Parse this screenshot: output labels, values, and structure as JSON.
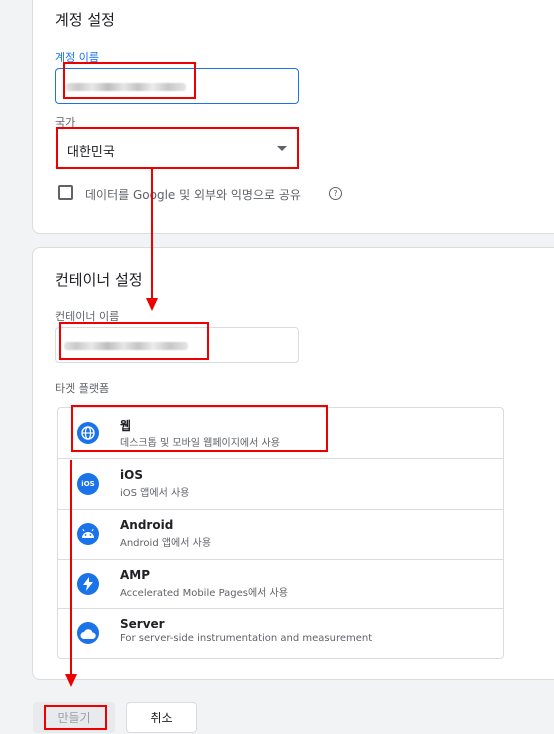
{
  "account_settings": {
    "title": "계정 설정",
    "account_name_label": "계정 이름",
    "country_label": "국가",
    "country_value": "대한민국",
    "share_data_label": "데이터를 Google 및 외부와 익명으로 공유",
    "help_glyph": "?"
  },
  "container_settings": {
    "title": "컨테이너 설정",
    "container_name_label": "컨테이너 이름",
    "target_platform_label": "타겟 플랫폼",
    "platforms": [
      {
        "icon": "globe-icon",
        "glyph": "⊕",
        "title": "웹",
        "desc": "데스크톱 및 모바일 웹페이지에서 사용"
      },
      {
        "icon": "ios-icon",
        "glyph": "iOS",
        "title": "iOS",
        "desc": "iOS 앱에서 사용"
      },
      {
        "icon": "android-icon",
        "glyph": "◒",
        "title": "Android",
        "desc": "Android 앱에서 사용"
      },
      {
        "icon": "lightning-icon",
        "glyph": "⚡",
        "title": "AMP",
        "desc": "Accelerated Mobile Pages에서 사용"
      },
      {
        "icon": "cloud-icon",
        "glyph": "☁",
        "title": "Server",
        "desc": "For server-side instrumentation and measurement"
      }
    ]
  },
  "actions": {
    "create_label": "만들기",
    "cancel_label": "취소"
  },
  "colors": {
    "accent": "#1a73e8",
    "annotation": "#ee0000"
  }
}
